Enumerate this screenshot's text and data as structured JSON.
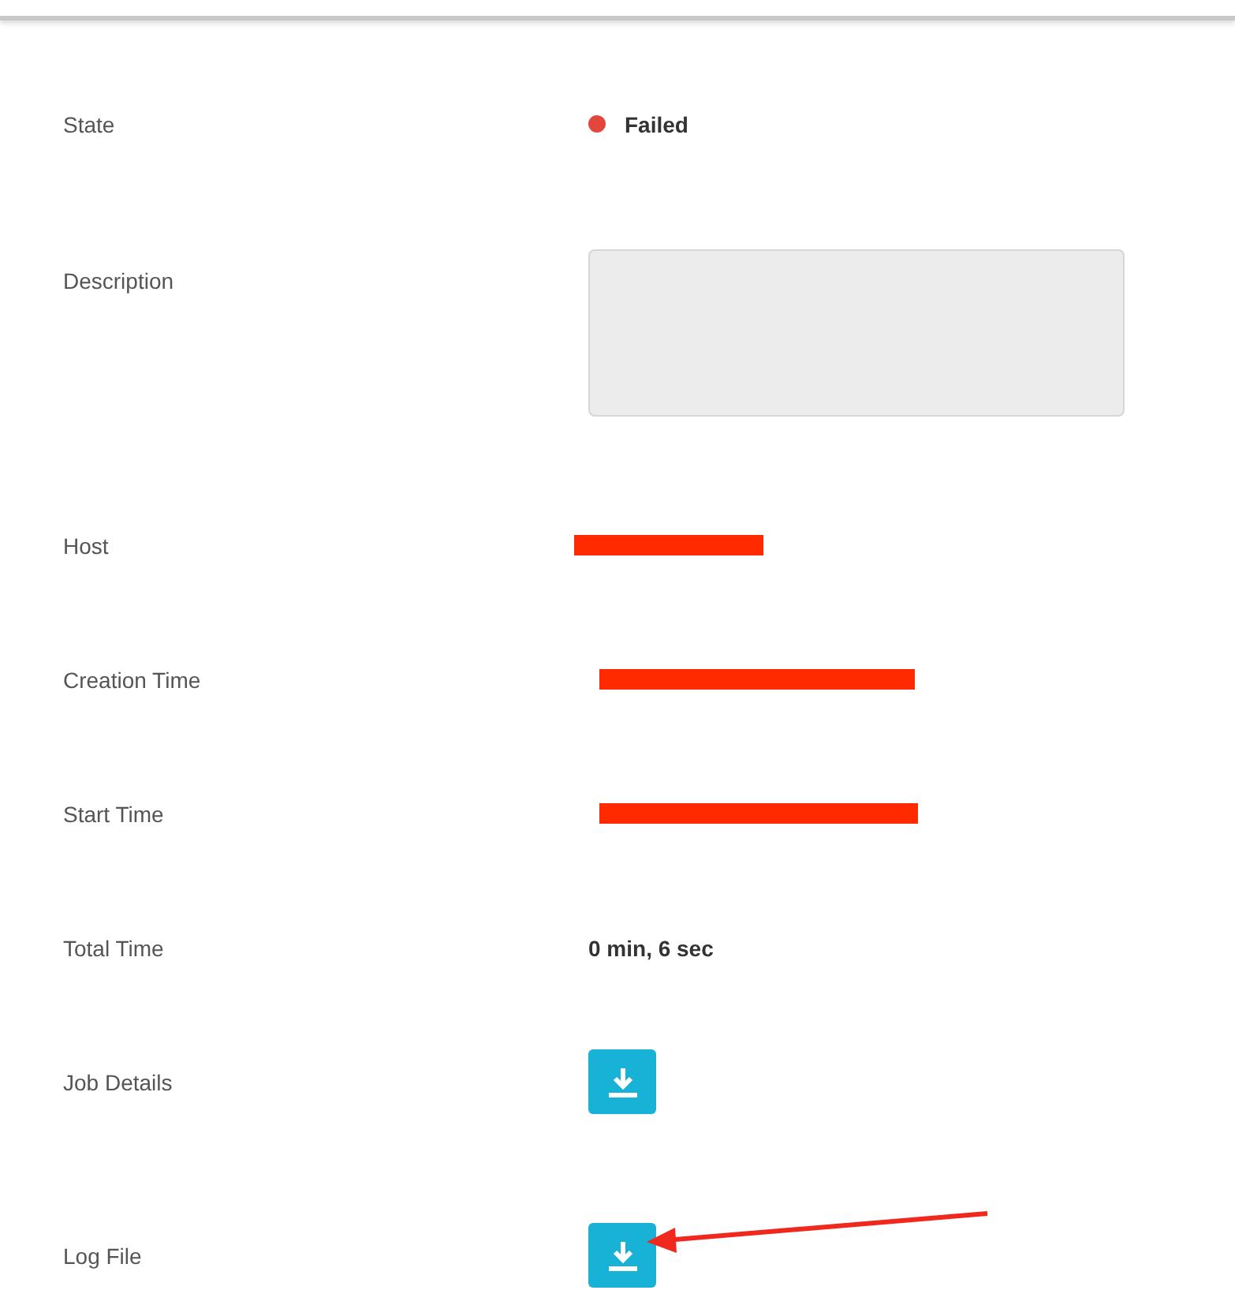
{
  "fields": [
    {
      "label": "State",
      "kind": "status",
      "value": "Failed"
    },
    {
      "label": "Description",
      "kind": "textarea"
    },
    {
      "label": "Host",
      "kind": "redacted"
    },
    {
      "label": "Creation Time",
      "kind": "redacted"
    },
    {
      "label": "Start Time",
      "kind": "redacted"
    },
    {
      "label": "Total Time",
      "kind": "text",
      "value": "0 min, 6 sec"
    },
    {
      "label": "Job Details",
      "kind": "download"
    },
    {
      "label": "Log File",
      "kind": "download"
    }
  ]
}
